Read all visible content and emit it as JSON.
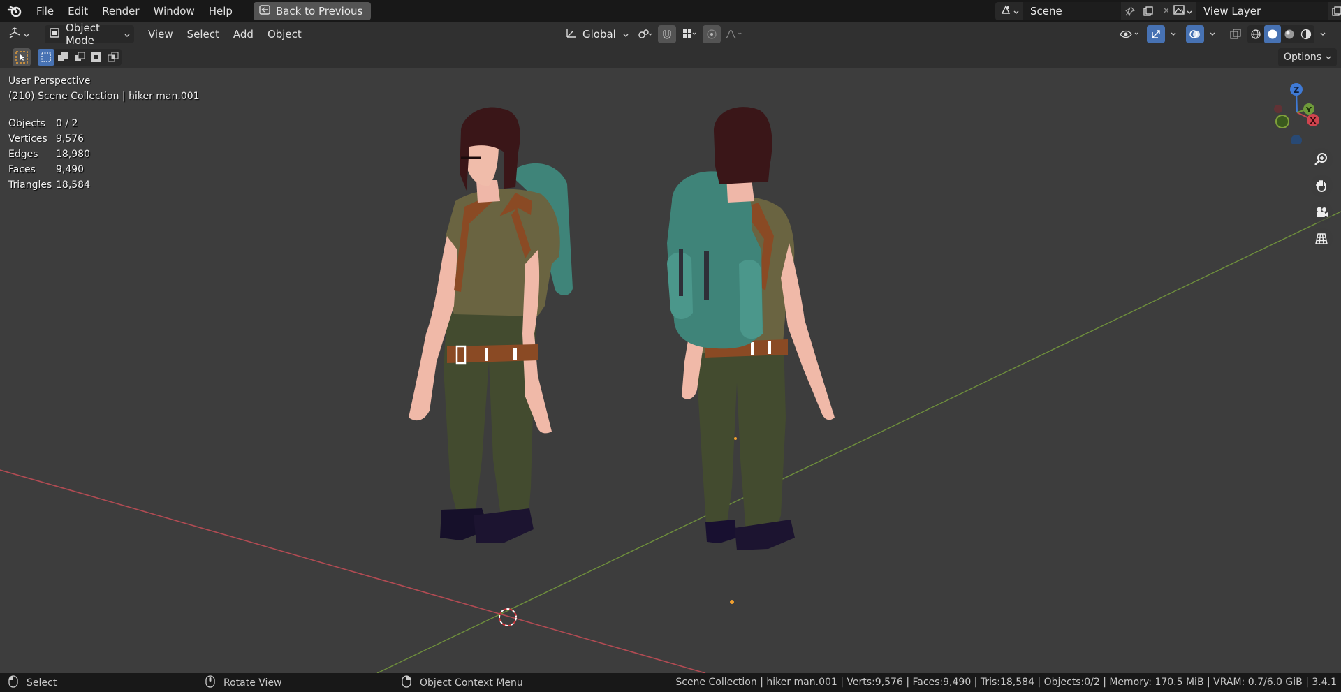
{
  "menu": {
    "items": [
      "File",
      "Edit",
      "Render",
      "Window",
      "Help"
    ],
    "back_button": "Back to Previous"
  },
  "scene": {
    "name": "Scene",
    "view_layer": "View Layer"
  },
  "header": {
    "mode": "Object Mode",
    "menus": [
      "View",
      "Select",
      "Add",
      "Object"
    ],
    "orientation": "Global"
  },
  "toolbar": {
    "options_label": "Options"
  },
  "viewport": {
    "perspective": "User Perspective",
    "collection_info": "(210) Scene Collection | hiker man.001",
    "stats": [
      {
        "label": "Objects",
        "value": "0 / 2"
      },
      {
        "label": "Vertices",
        "value": "9,576"
      },
      {
        "label": "Edges",
        "value": "18,980"
      },
      {
        "label": "Faces",
        "value": "9,490"
      },
      {
        "label": "Triangles",
        "value": "18,584"
      }
    ],
    "gizmo": {
      "z": "Z",
      "y": "Y",
      "x": "X"
    }
  },
  "statusbar": {
    "select": "Select",
    "rotate": "Rotate View",
    "context": "Object Context Menu",
    "info": "Scene Collection | hiker man.001 | Verts:9,576 | Faces:9,490 | Tris:18,584 | Objects:0/2 | Memory: 170.5 MiB | VRAM: 0.7/6.0 GiB | 3.4.1"
  },
  "colors": {
    "accent": "#4772b3",
    "x_axis": "#c6474f",
    "y_axis": "#6e9a3a",
    "z_axis": "#3f7ad6"
  }
}
